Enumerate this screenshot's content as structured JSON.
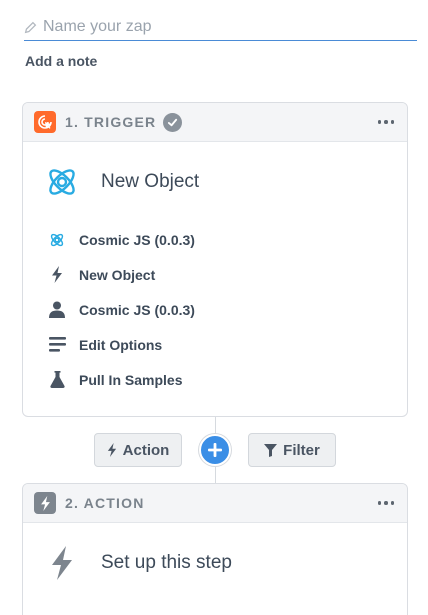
{
  "zap": {
    "name_placeholder": "Name your zap",
    "name_value": "",
    "add_note_label": "Add a note"
  },
  "trigger": {
    "header_label": "1. TRIGGER",
    "badge_icon": "cursor-click-icon",
    "status_icon": "check-icon",
    "title": "New Object",
    "items": [
      {
        "icon": "cosmic-js-icon",
        "label": "Cosmic JS (0.0.3)"
      },
      {
        "icon": "lightning-icon",
        "label": "New Object"
      },
      {
        "icon": "user-icon",
        "label": "Cosmic JS (0.0.3)"
      },
      {
        "icon": "options-icon",
        "label": "Edit Options"
      },
      {
        "icon": "flask-icon",
        "label": "Pull In Samples"
      }
    ]
  },
  "connector": {
    "action_label": "Action",
    "filter_label": "Filter"
  },
  "action": {
    "header_label": "2. ACTION",
    "badge_icon": "lightning-icon",
    "title": "Set up this step"
  },
  "colors": {
    "accent_blue": "#3a8ee6",
    "trigger_orange": "#ff6a2b",
    "cosmic_blue": "#29abe2",
    "text_dark": "#3d4a59",
    "muted_gray": "#7a838c"
  }
}
